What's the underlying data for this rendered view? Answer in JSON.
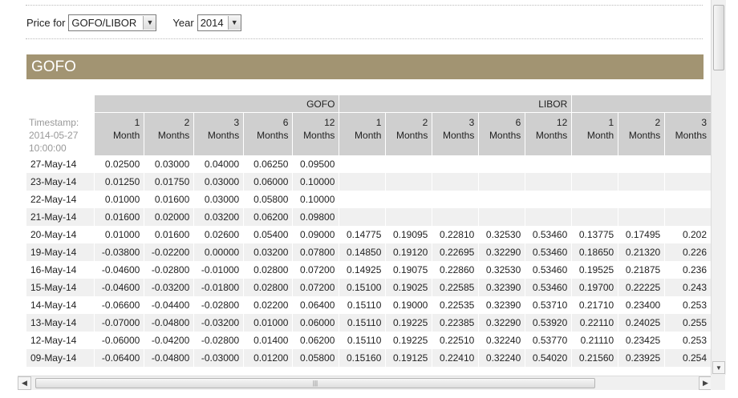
{
  "controls": {
    "price_label": "Price for",
    "price_value": "GOFO/LIBOR",
    "year_label": "Year",
    "year_value": "2014"
  },
  "banner": {
    "title": "GOFO"
  },
  "table": {
    "group_headers": [
      "GOFO",
      "LIBOR",
      ""
    ],
    "timestamp": "Timestamp: 2014-05-27 10:00:00",
    "columns": [
      [
        "1",
        "Month"
      ],
      [
        "2",
        "Months"
      ],
      [
        "3",
        "Months"
      ],
      [
        "6",
        "Months"
      ],
      [
        "12",
        "Months"
      ],
      [
        "1",
        "Month"
      ],
      [
        "2",
        "Months"
      ],
      [
        "3",
        "Months"
      ],
      [
        "6",
        "Months"
      ],
      [
        "12",
        "Months"
      ],
      [
        "1",
        "Month"
      ],
      [
        "2",
        "Months"
      ],
      [
        "3",
        "Months"
      ]
    ],
    "rows": [
      [
        "27-May-14",
        "0.02500",
        "0.03000",
        "0.04000",
        "0.06250",
        "0.09500",
        "",
        "",
        "",
        "",
        "",
        "",
        "",
        ""
      ],
      [
        "23-May-14",
        "0.01250",
        "0.01750",
        "0.03000",
        "0.06000",
        "0.10000",
        "",
        "",
        "",
        "",
        "",
        "",
        "",
        ""
      ],
      [
        "22-May-14",
        "0.01000",
        "0.01600",
        "0.03000",
        "0.05800",
        "0.10000",
        "",
        "",
        "",
        "",
        "",
        "",
        "",
        ""
      ],
      [
        "21-May-14",
        "0.01600",
        "0.02000",
        "0.03200",
        "0.06200",
        "0.09800",
        "",
        "",
        "",
        "",
        "",
        "",
        "",
        ""
      ],
      [
        "20-May-14",
        "0.01000",
        "0.01600",
        "0.02600",
        "0.05400",
        "0.09000",
        "0.14775",
        "0.19095",
        "0.22810",
        "0.32530",
        "0.53460",
        "0.13775",
        "0.17495",
        "0.202"
      ],
      [
        "19-May-14",
        "-0.03800",
        "-0.02200",
        "0.00000",
        "0.03200",
        "0.07800",
        "0.14850",
        "0.19120",
        "0.22695",
        "0.32290",
        "0.53460",
        "0.18650",
        "0.21320",
        "0.226"
      ],
      [
        "16-May-14",
        "-0.04600",
        "-0.02800",
        "-0.01000",
        "0.02800",
        "0.07200",
        "0.14925",
        "0.19075",
        "0.22860",
        "0.32530",
        "0.53460",
        "0.19525",
        "0.21875",
        "0.236"
      ],
      [
        "15-May-14",
        "-0.04600",
        "-0.03200",
        "-0.01800",
        "0.02800",
        "0.07200",
        "0.15100",
        "0.19025",
        "0.22585",
        "0.32390",
        "0.53460",
        "0.19700",
        "0.22225",
        "0.243"
      ],
      [
        "14-May-14",
        "-0.06600",
        "-0.04400",
        "-0.02800",
        "0.02200",
        "0.06400",
        "0.15110",
        "0.19000",
        "0.22535",
        "0.32390",
        "0.53710",
        "0.21710",
        "0.23400",
        "0.253"
      ],
      [
        "13-May-14",
        "-0.07000",
        "-0.04800",
        "-0.03200",
        "0.01000",
        "0.06000",
        "0.15110",
        "0.19225",
        "0.22385",
        "0.32290",
        "0.53920",
        "0.22110",
        "0.24025",
        "0.255"
      ],
      [
        "12-May-14",
        "-0.06000",
        "-0.04200",
        "-0.02800",
        "0.01400",
        "0.06200",
        "0.15110",
        "0.19225",
        "0.22510",
        "0.32240",
        "0.53770",
        "0.21110",
        "0.23425",
        "0.253"
      ],
      [
        "09-May-14",
        "-0.06400",
        "-0.04800",
        "-0.03000",
        "0.01200",
        "0.05800",
        "0.15160",
        "0.19125",
        "0.22410",
        "0.32240",
        "0.54020",
        "0.21560",
        "0.23925",
        "0.254"
      ]
    ]
  }
}
